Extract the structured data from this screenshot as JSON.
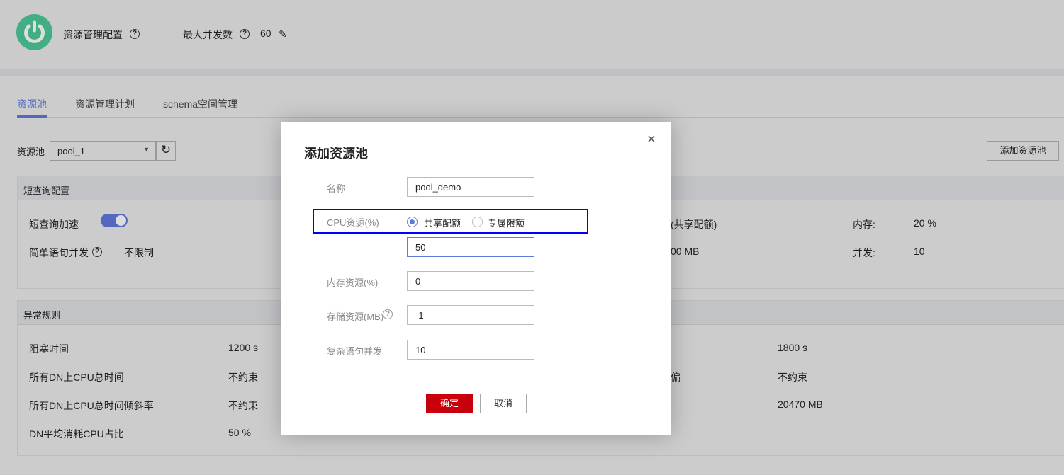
{
  "header": {
    "title": "资源管理配置",
    "max_concurrency_label": "最大并发数",
    "max_concurrency_value": "60"
  },
  "tabs": [
    {
      "label": "资源池",
      "active": true
    },
    {
      "label": "资源管理计划"
    },
    {
      "label": "schema空间管理"
    }
  ],
  "toolbar": {
    "pool_label": "资源池",
    "pool_value": "pool_1",
    "add_button": "添加资源池"
  },
  "short_query": {
    "title": "短查询配置",
    "accel_label": "短查询加速",
    "accel_on": true,
    "simple_label": "简单语句并发",
    "simple_value": "不限制",
    "cpu_partial": "(共享配额)",
    "storage_partial": "00 MB",
    "mem_label": "内存:",
    "mem_value": "20 %",
    "conc_label": "并发:",
    "conc_value": "10"
  },
  "exception_rules": {
    "title": "异常规则",
    "rows": [
      {
        "label": "阻塞时间",
        "value": "1200 s"
      },
      {
        "label": "所有DN上CPU总时间",
        "value": "不约束"
      },
      {
        "label": "所有DN上CPU总时间倾斜率",
        "value": "不约束"
      },
      {
        "label": "DN平均消耗CPU占比",
        "value": "50 %"
      }
    ],
    "right_rows": [
      {
        "label": "",
        "value": "1800 s"
      },
      {
        "label": "偏",
        "value": "不约束"
      },
      {
        "label": "",
        "value": "20470 MB"
      }
    ]
  },
  "modal": {
    "title": "添加资源池",
    "name_label": "名称",
    "name_value": "pool_demo",
    "cpu_label": "CPU资源(%)",
    "cpu_options": [
      "共享配额",
      "专属限额"
    ],
    "cpu_selected": 0,
    "cpu_value": "50",
    "mem_label": "内存资源(%)",
    "mem_value": "0",
    "storage_label": "存储资源(MB)",
    "storage_value": "-1",
    "complex_label": "复杂语句并发",
    "complex_value": "10",
    "ok": "确定",
    "cancel": "取消"
  },
  "colors": {
    "accent": "#5e7ce0",
    "primary_button": "#c7000b",
    "highlight": "#0000ff",
    "logo": "#41ae84"
  }
}
